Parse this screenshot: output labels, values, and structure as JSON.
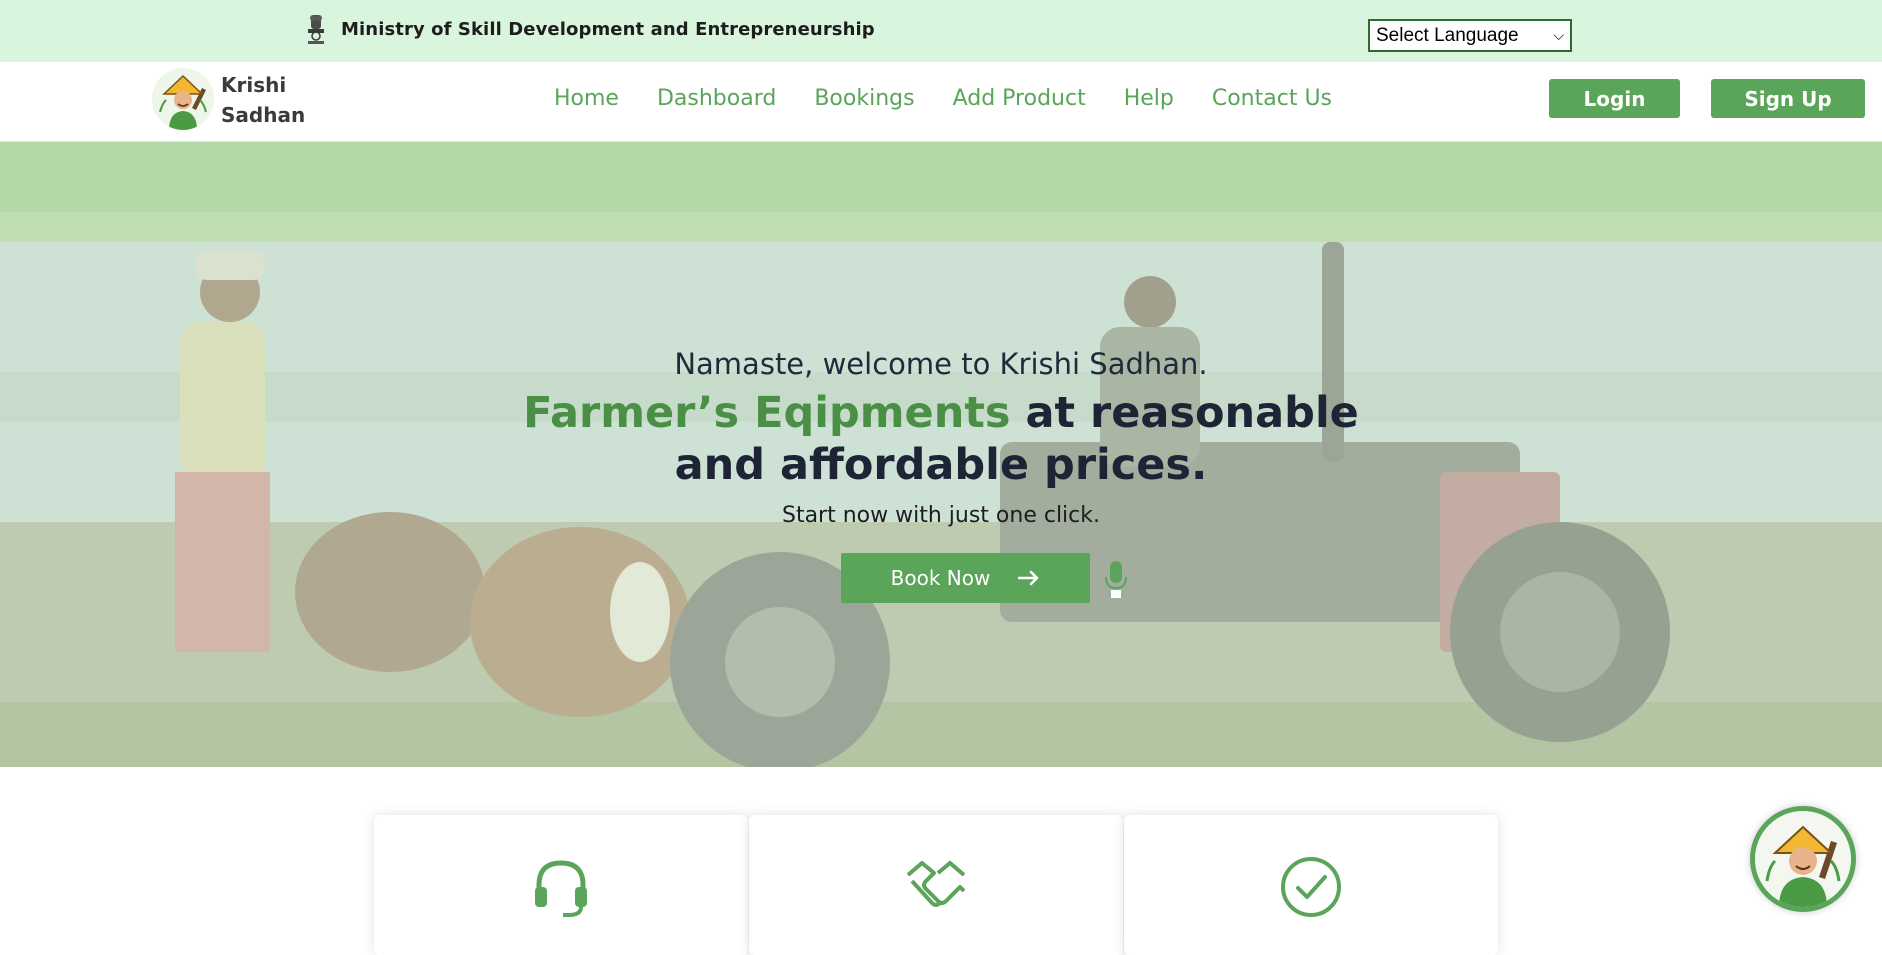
{
  "topbar": {
    "ministry_name": "Ministry of Skill Development and Entrepreneurship",
    "emblem_icon": "state-emblem-icon",
    "language_select": {
      "selected": "Select Language"
    }
  },
  "navbar": {
    "brand_line1": "Krishi",
    "brand_line2": "Sadhan",
    "links": [
      "Home",
      "Dashboard",
      "Bookings",
      "Add Product",
      "Help",
      "Contact Us"
    ],
    "login_label": "Login",
    "signup_label": "Sign Up"
  },
  "hero": {
    "greeting": "Namaste, welcome to Krishi Sadhan.",
    "headline_green": "Farmer’s Eqipments",
    "headline_rest_1": " at reasonable",
    "headline_rest_2": "and affordable prices.",
    "subtext": "Start now with just one click.",
    "book_label": "Book Now",
    "book_icon": "arrow-right-icon",
    "mic_icon": "microphone-icon"
  },
  "features": {
    "icons": [
      "headset-icon",
      "handshake-icon",
      "check-circle-icon"
    ]
  },
  "colors": {
    "accent_green": "#5aa55a",
    "topbar_bg": "#daf5de",
    "headline_dark": "#1c2436"
  }
}
